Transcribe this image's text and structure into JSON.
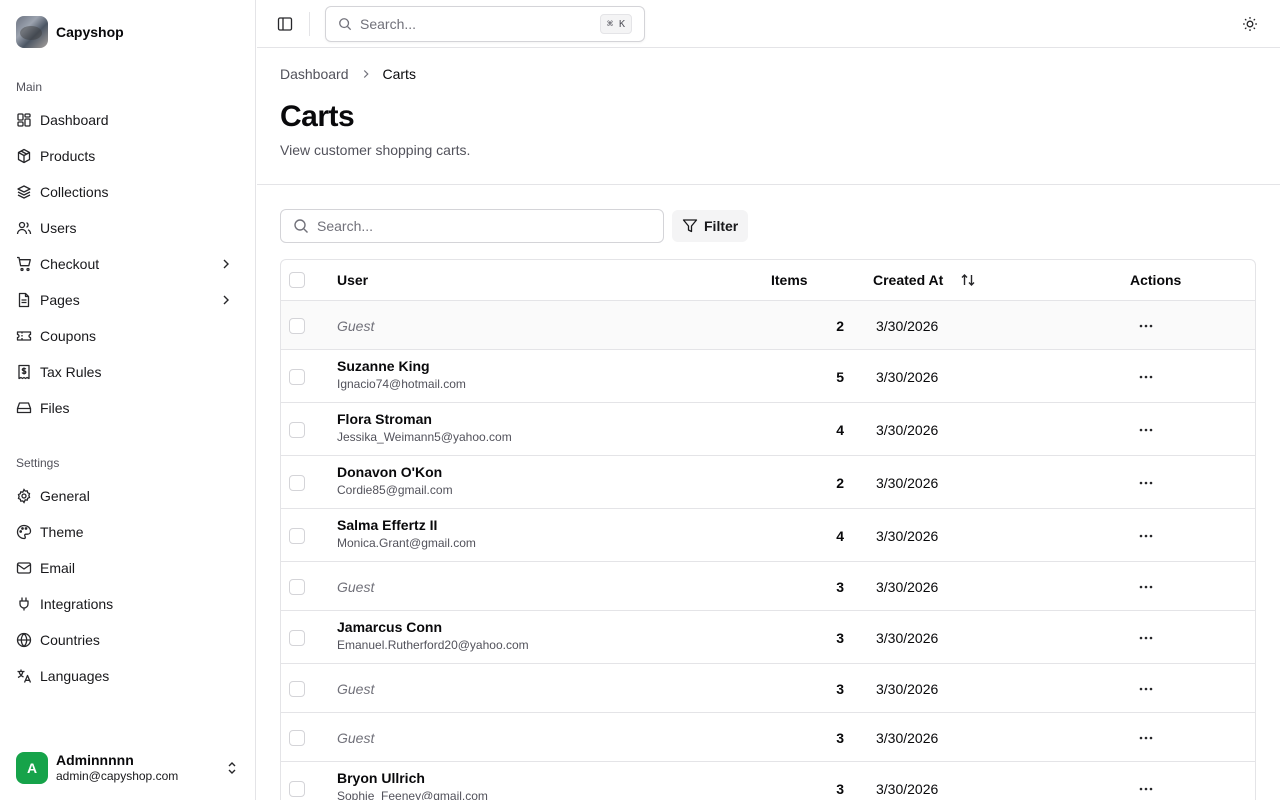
{
  "app": {
    "name": "Capyshop"
  },
  "sidebar": {
    "main_label": "Main",
    "main_items": [
      {
        "label": "Dashboard",
        "icon": "dashboard-icon"
      },
      {
        "label": "Products",
        "icon": "package-icon"
      },
      {
        "label": "Collections",
        "icon": "layers-icon"
      },
      {
        "label": "Users",
        "icon": "users-icon"
      },
      {
        "label": "Checkout",
        "icon": "cart-icon",
        "has_children": true
      },
      {
        "label": "Pages",
        "icon": "file-icon",
        "has_children": true
      },
      {
        "label": "Coupons",
        "icon": "ticket-icon"
      },
      {
        "label": "Tax Rules",
        "icon": "receipt-icon"
      },
      {
        "label": "Files",
        "icon": "drive-icon"
      }
    ],
    "settings_label": "Settings",
    "settings_items": [
      {
        "label": "General",
        "icon": "gear-icon"
      },
      {
        "label": "Theme",
        "icon": "palette-icon"
      },
      {
        "label": "Email",
        "icon": "mail-icon"
      },
      {
        "label": "Integrations",
        "icon": "plug-icon"
      },
      {
        "label": "Countries",
        "icon": "globe-icon"
      },
      {
        "label": "Languages",
        "icon": "translate-icon"
      }
    ],
    "user": {
      "initial": "A",
      "name": "Adminnnnn",
      "email": "admin@capyshop.com"
    }
  },
  "topbar": {
    "search_placeholder": "Search...",
    "shortcut": "⌘ K"
  },
  "breadcrumb": {
    "parent": "Dashboard",
    "current": "Carts"
  },
  "page": {
    "title": "Carts",
    "subtitle": "View customer shopping carts."
  },
  "toolbar": {
    "search_placeholder": "Search...",
    "filter_label": "Filter"
  },
  "table": {
    "columns": {
      "user": "User",
      "items": "Items",
      "created_at": "Created At",
      "actions": "Actions"
    },
    "rows": [
      {
        "guest": true,
        "name": "Guest",
        "email": "",
        "items": "2",
        "created_at": "3/30/2026"
      },
      {
        "guest": false,
        "name": "Suzanne King",
        "email": "Ignacio74@hotmail.com",
        "items": "5",
        "created_at": "3/30/2026"
      },
      {
        "guest": false,
        "name": "Flora Stroman",
        "email": "Jessika_Weimann5@yahoo.com",
        "items": "4",
        "created_at": "3/30/2026"
      },
      {
        "guest": false,
        "name": "Donavon O'Kon",
        "email": "Cordie85@gmail.com",
        "items": "2",
        "created_at": "3/30/2026"
      },
      {
        "guest": false,
        "name": "Salma Effertz II",
        "email": "Monica.Grant@gmail.com",
        "items": "4",
        "created_at": "3/30/2026"
      },
      {
        "guest": true,
        "name": "Guest",
        "email": "",
        "items": "3",
        "created_at": "3/30/2026"
      },
      {
        "guest": false,
        "name": "Jamarcus Conn",
        "email": "Emanuel.Rutherford20@yahoo.com",
        "items": "3",
        "created_at": "3/30/2026"
      },
      {
        "guest": true,
        "name": "Guest",
        "email": "",
        "items": "3",
        "created_at": "3/30/2026"
      },
      {
        "guest": true,
        "name": "Guest",
        "email": "",
        "items": "3",
        "created_at": "3/30/2026"
      },
      {
        "guest": false,
        "name": "Bryon Ullrich",
        "email": "Sophie_Feeney@gmail.com",
        "items": "3",
        "created_at": "3/30/2026"
      }
    ]
  }
}
